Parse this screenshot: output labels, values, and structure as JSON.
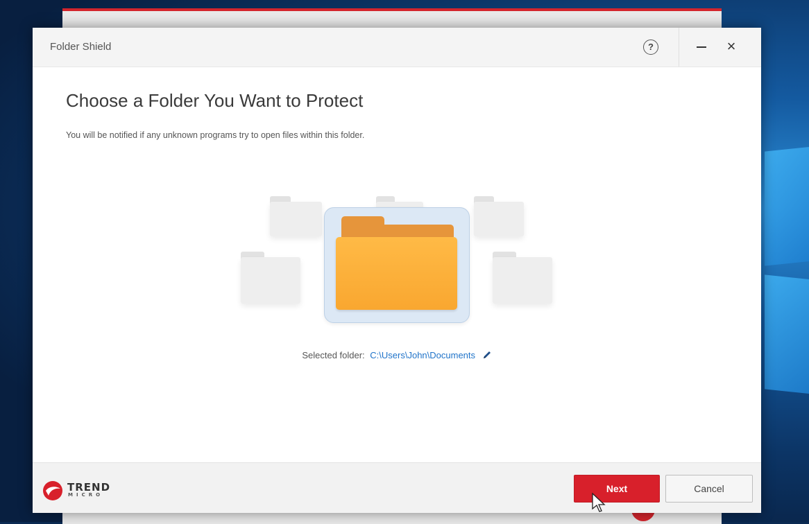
{
  "window": {
    "title": "Folder Shield",
    "help_label": "?",
    "close_label": "×"
  },
  "content": {
    "heading": "Choose a Folder You Want to Protect",
    "description": "You will be notified if any unknown programs try to open files within this folder.",
    "selected_label": "Selected folder:",
    "selected_path": "C:\\Users\\John\\Documents"
  },
  "brand": {
    "name": "TREND",
    "sub": "MICRO"
  },
  "buttons": {
    "next": "Next",
    "cancel": "Cancel"
  },
  "colors": {
    "accent": "#d8202b",
    "link": "#1f73c9",
    "folder": "#f9a730"
  }
}
